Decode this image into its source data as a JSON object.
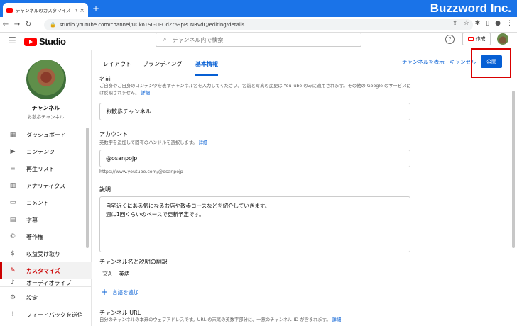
{
  "browser": {
    "tab_title": "チャンネルのカスタマイズ - YouTube S",
    "new_tab": "+",
    "watermark": "Buzzword Inc.",
    "url": "studio.youtube.com/channel/UCkoTSL-UFOdZt69pPCNRvdQ/editing/details"
  },
  "header": {
    "logo_text": "Studio",
    "search_placeholder": "チャンネル内で検索",
    "create_label": "作成",
    "help": "?"
  },
  "sidebar": {
    "channel_name": "チャンネル",
    "channel_sub": "お散歩チャンネル",
    "items": [
      {
        "icon": "▦",
        "label": "ダッシュボード"
      },
      {
        "icon": "▶",
        "label": "コンテンツ"
      },
      {
        "icon": "≡",
        "label": "再生リスト"
      },
      {
        "icon": "▥",
        "label": "アナリティクス"
      },
      {
        "icon": "▭",
        "label": "コメント"
      },
      {
        "icon": "▤",
        "label": "字幕"
      },
      {
        "icon": "©",
        "label": "著作権"
      },
      {
        "icon": "$",
        "label": "収益受け取り"
      },
      {
        "icon": "✎",
        "label": "カスタマイズ"
      },
      {
        "icon": "♪",
        "label": "オーディオライブ"
      }
    ],
    "settings": "設定",
    "feedback": "フィードバックを送信"
  },
  "tabs": [
    "レイアウト",
    "ブランディング",
    "基本情報"
  ],
  "actions": {
    "view_channel": "チャンネルを表示",
    "cancel": "キャンセル",
    "publish": "公開"
  },
  "name_section": {
    "title": "名前",
    "desc": "ご自身やご自身のコンテンツを表すチャンネル名を入力してください。名前と写真の変更は YouTube のみに適用されます。その他の Google のサービスには反映されません。",
    "more": "詳細",
    "value": "お散歩チャンネル"
  },
  "account_section": {
    "title": "アカウント",
    "desc": "英数字を追加して固有のハンドルを選択します。",
    "more": "詳細",
    "value": "@osanpojp",
    "url": "https://www.youtube.com/@osanpojp"
  },
  "desc_section": {
    "title": "説明",
    "line1": "自宅近くにある気になるお店や散歩コースなどを紹介していきます。",
    "line2": "週に1回くらいのペースで更新予定です。"
  },
  "translation": {
    "title": "チャンネル名と説明の翻訳",
    "language": "英語",
    "add": "言語を追加"
  },
  "channel_url": {
    "title": "チャンネル URL",
    "desc": "自分のチャンネルの本来のウェブアドレスです。URL の末尾の英数字部分に、一意のチャンネル ID が含まれます。",
    "more": "詳細"
  }
}
